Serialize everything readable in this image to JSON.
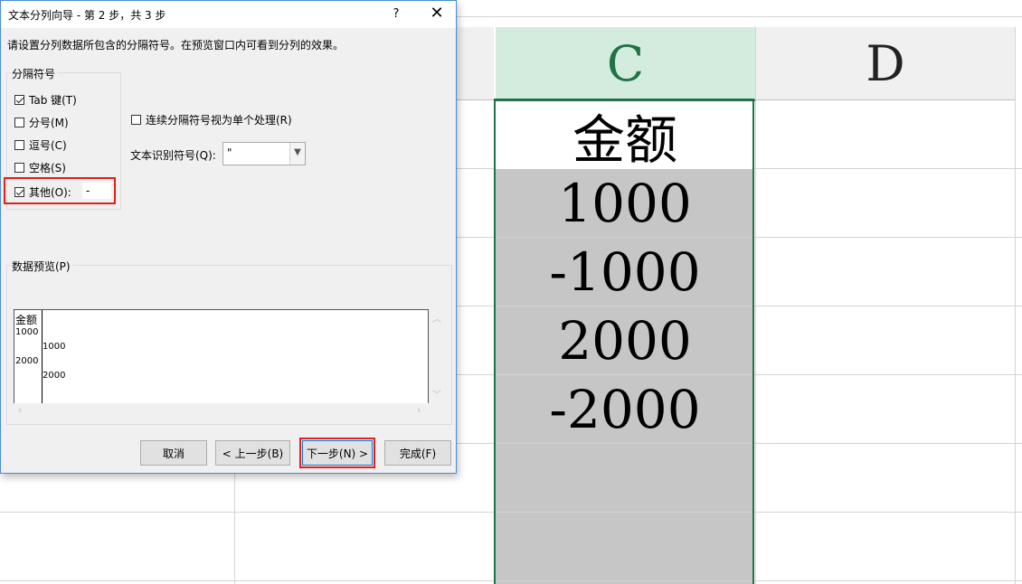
{
  "sheet": {
    "columns": [
      {
        "letter": "C"
      },
      {
        "letter": "D"
      }
    ],
    "cells": [
      "金额",
      "1000",
      "-1000",
      "2000",
      "-2000"
    ]
  },
  "dialog": {
    "title": "文本分列向导 - 第 2 步，共 3 步",
    "help": "?",
    "close": "✕",
    "instructions": "请设置分列数据所包含的分隔符号。在预览窗口内可看到分列的效果。",
    "delimiters_label": "分隔符号",
    "delimiters": [
      {
        "label": "Tab 键(T)",
        "checked": true
      },
      {
        "label": "分号(M)",
        "checked": false
      },
      {
        "label": "逗号(C)",
        "checked": false
      },
      {
        "label": "空格(S)",
        "checked": false
      },
      {
        "label": "其他(O):",
        "checked": true
      }
    ],
    "other_value": "-",
    "treat_consecutive": "连续分隔符号视为单个处理(R)",
    "treat_consecutive_checked": false,
    "qualifier_label": "文本识别符号(Q):",
    "qualifier_value": "\"",
    "preview_label": "数据预览(P)",
    "preview_rows": [
      [
        "金额",
        ""
      ],
      [
        "1000",
        ""
      ],
      [
        "",
        "1000"
      ],
      [
        "2000",
        ""
      ],
      [
        "",
        "2000"
      ]
    ],
    "buttons": {
      "cancel": "取消",
      "back": "< 上一步(B)",
      "next": "下一步(N) >",
      "finish": "完成(F)"
    }
  }
}
